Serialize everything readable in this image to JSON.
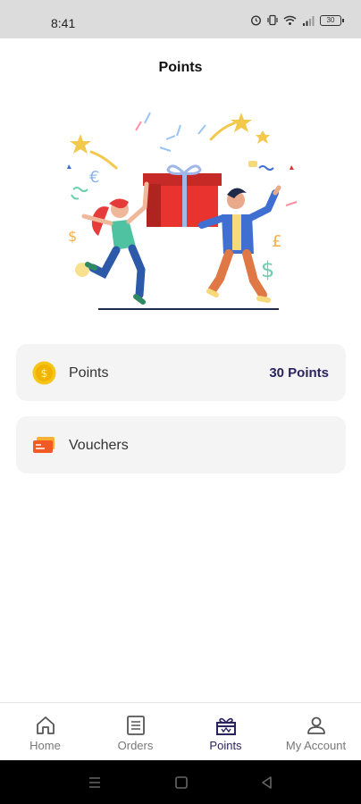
{
  "status_bar": {
    "time": "8:41",
    "battery": "30"
  },
  "header": {
    "title": "Points"
  },
  "cards": [
    {
      "label": "Points",
      "value": "30 Points",
      "icon": "coin-icon"
    },
    {
      "label": "Vouchers",
      "value": "",
      "icon": "voucher-icon"
    }
  ],
  "bottom_nav": {
    "items": [
      {
        "label": "Home",
        "icon": "home-icon",
        "active": false
      },
      {
        "label": "Orders",
        "icon": "orders-icon",
        "active": false
      },
      {
        "label": "Points",
        "icon": "gift-icon",
        "active": true
      },
      {
        "label": "My Account",
        "icon": "account-icon",
        "active": false
      }
    ]
  },
  "colors": {
    "accent": "#2b2360",
    "card_bg": "#f4f4f4",
    "gift": "#e8332f",
    "coin": "#f5c518"
  }
}
